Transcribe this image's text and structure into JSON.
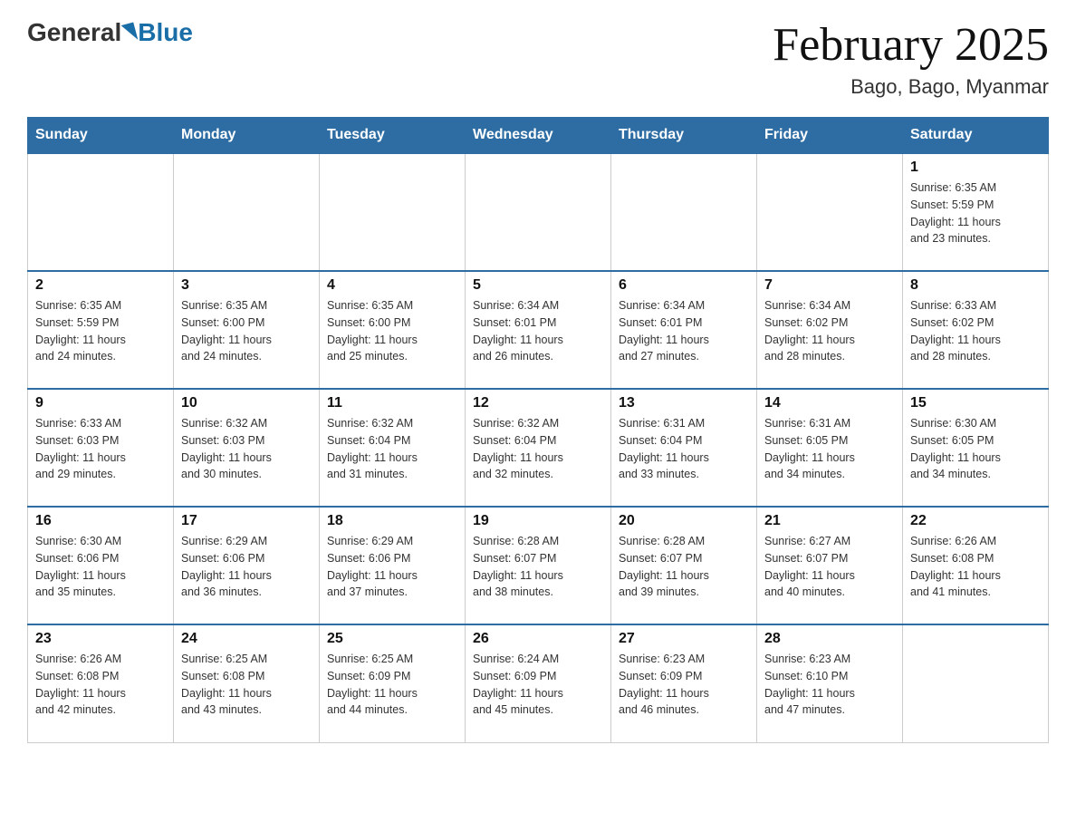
{
  "header": {
    "logo_general": "General",
    "logo_blue": "Blue",
    "month_title": "February 2025",
    "location": "Bago, Bago, Myanmar"
  },
  "weekdays": [
    "Sunday",
    "Monday",
    "Tuesday",
    "Wednesday",
    "Thursday",
    "Friday",
    "Saturday"
  ],
  "weeks": [
    [
      {
        "day": "",
        "info": ""
      },
      {
        "day": "",
        "info": ""
      },
      {
        "day": "",
        "info": ""
      },
      {
        "day": "",
        "info": ""
      },
      {
        "day": "",
        "info": ""
      },
      {
        "day": "",
        "info": ""
      },
      {
        "day": "1",
        "info": "Sunrise: 6:35 AM\nSunset: 5:59 PM\nDaylight: 11 hours\nand 23 minutes."
      }
    ],
    [
      {
        "day": "2",
        "info": "Sunrise: 6:35 AM\nSunset: 5:59 PM\nDaylight: 11 hours\nand 24 minutes."
      },
      {
        "day": "3",
        "info": "Sunrise: 6:35 AM\nSunset: 6:00 PM\nDaylight: 11 hours\nand 24 minutes."
      },
      {
        "day": "4",
        "info": "Sunrise: 6:35 AM\nSunset: 6:00 PM\nDaylight: 11 hours\nand 25 minutes."
      },
      {
        "day": "5",
        "info": "Sunrise: 6:34 AM\nSunset: 6:01 PM\nDaylight: 11 hours\nand 26 minutes."
      },
      {
        "day": "6",
        "info": "Sunrise: 6:34 AM\nSunset: 6:01 PM\nDaylight: 11 hours\nand 27 minutes."
      },
      {
        "day": "7",
        "info": "Sunrise: 6:34 AM\nSunset: 6:02 PM\nDaylight: 11 hours\nand 28 minutes."
      },
      {
        "day": "8",
        "info": "Sunrise: 6:33 AM\nSunset: 6:02 PM\nDaylight: 11 hours\nand 28 minutes."
      }
    ],
    [
      {
        "day": "9",
        "info": "Sunrise: 6:33 AM\nSunset: 6:03 PM\nDaylight: 11 hours\nand 29 minutes."
      },
      {
        "day": "10",
        "info": "Sunrise: 6:32 AM\nSunset: 6:03 PM\nDaylight: 11 hours\nand 30 minutes."
      },
      {
        "day": "11",
        "info": "Sunrise: 6:32 AM\nSunset: 6:04 PM\nDaylight: 11 hours\nand 31 minutes."
      },
      {
        "day": "12",
        "info": "Sunrise: 6:32 AM\nSunset: 6:04 PM\nDaylight: 11 hours\nand 32 minutes."
      },
      {
        "day": "13",
        "info": "Sunrise: 6:31 AM\nSunset: 6:04 PM\nDaylight: 11 hours\nand 33 minutes."
      },
      {
        "day": "14",
        "info": "Sunrise: 6:31 AM\nSunset: 6:05 PM\nDaylight: 11 hours\nand 34 minutes."
      },
      {
        "day": "15",
        "info": "Sunrise: 6:30 AM\nSunset: 6:05 PM\nDaylight: 11 hours\nand 34 minutes."
      }
    ],
    [
      {
        "day": "16",
        "info": "Sunrise: 6:30 AM\nSunset: 6:06 PM\nDaylight: 11 hours\nand 35 minutes."
      },
      {
        "day": "17",
        "info": "Sunrise: 6:29 AM\nSunset: 6:06 PM\nDaylight: 11 hours\nand 36 minutes."
      },
      {
        "day": "18",
        "info": "Sunrise: 6:29 AM\nSunset: 6:06 PM\nDaylight: 11 hours\nand 37 minutes."
      },
      {
        "day": "19",
        "info": "Sunrise: 6:28 AM\nSunset: 6:07 PM\nDaylight: 11 hours\nand 38 minutes."
      },
      {
        "day": "20",
        "info": "Sunrise: 6:28 AM\nSunset: 6:07 PM\nDaylight: 11 hours\nand 39 minutes."
      },
      {
        "day": "21",
        "info": "Sunrise: 6:27 AM\nSunset: 6:07 PM\nDaylight: 11 hours\nand 40 minutes."
      },
      {
        "day": "22",
        "info": "Sunrise: 6:26 AM\nSunset: 6:08 PM\nDaylight: 11 hours\nand 41 minutes."
      }
    ],
    [
      {
        "day": "23",
        "info": "Sunrise: 6:26 AM\nSunset: 6:08 PM\nDaylight: 11 hours\nand 42 minutes."
      },
      {
        "day": "24",
        "info": "Sunrise: 6:25 AM\nSunset: 6:08 PM\nDaylight: 11 hours\nand 43 minutes."
      },
      {
        "day": "25",
        "info": "Sunrise: 6:25 AM\nSunset: 6:09 PM\nDaylight: 11 hours\nand 44 minutes."
      },
      {
        "day": "26",
        "info": "Sunrise: 6:24 AM\nSunset: 6:09 PM\nDaylight: 11 hours\nand 45 minutes."
      },
      {
        "day": "27",
        "info": "Sunrise: 6:23 AM\nSunset: 6:09 PM\nDaylight: 11 hours\nand 46 minutes."
      },
      {
        "day": "28",
        "info": "Sunrise: 6:23 AM\nSunset: 6:10 PM\nDaylight: 11 hours\nand 47 minutes."
      },
      {
        "day": "",
        "info": ""
      }
    ]
  ]
}
